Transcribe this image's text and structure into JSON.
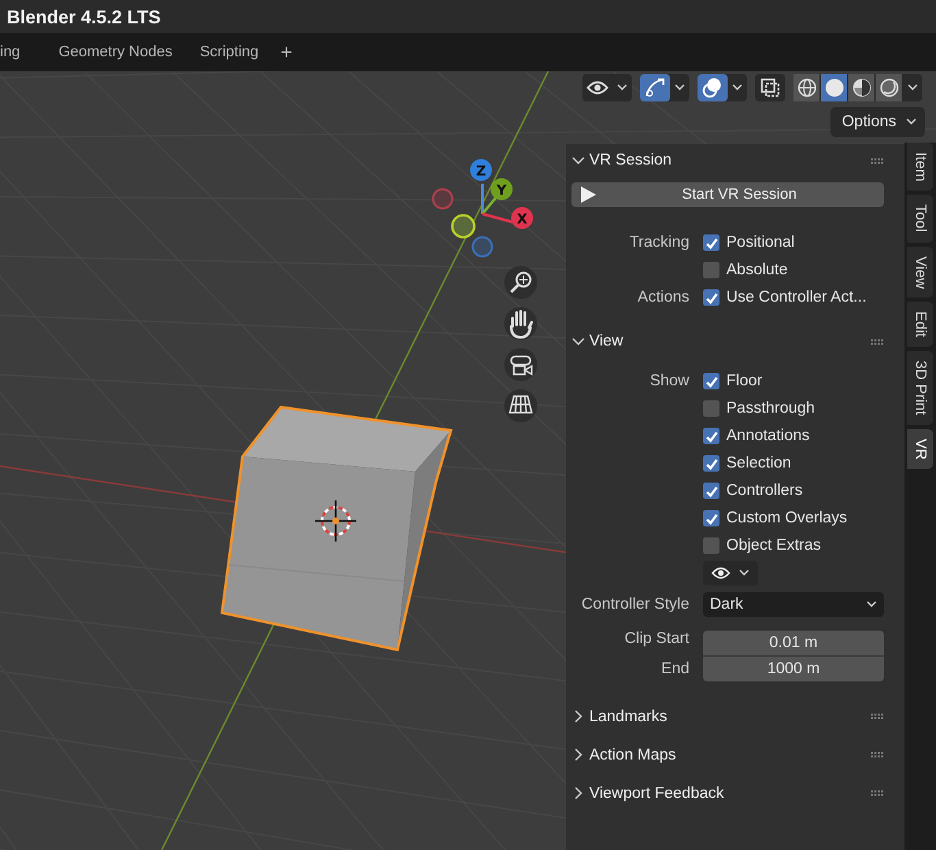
{
  "window": {
    "title": "Blender 4.5.2 LTS"
  },
  "workspace_tabs": [
    {
      "label": "ing",
      "selected": false
    },
    {
      "label": "Geometry Nodes",
      "selected": false
    },
    {
      "label": "Scripting",
      "selected": false
    }
  ],
  "add_tab": "+",
  "gizmo_axes": [
    {
      "label": "Z",
      "color": "#2f7fdc"
    },
    {
      "label": "Y",
      "color": "#6ea01e"
    },
    {
      "label": "X",
      "color": "#e0344e"
    }
  ],
  "header_toggles": [
    {
      "kind": "visibility",
      "on": false
    },
    {
      "kind": "gizmo",
      "on": true
    },
    {
      "kind": "overlay",
      "on": true
    },
    {
      "kind": "xray",
      "on": false
    }
  ],
  "shading_modes": [
    {
      "kind": "wireframe",
      "selected": false
    },
    {
      "kind": "solid",
      "selected": true
    },
    {
      "kind": "material",
      "selected": false
    },
    {
      "kind": "rendered",
      "selected": false
    }
  ],
  "options_button": "Options",
  "vr_session": {
    "title": "VR Session",
    "expanded": true,
    "start_button": "Start VR Session",
    "tracking_label": "Tracking",
    "tracking": [
      {
        "label": "Positional",
        "checked": true
      },
      {
        "label": "Absolute",
        "checked": false
      }
    ],
    "actions_label": "Actions",
    "actions": [
      {
        "label": "Use Controller Act...",
        "checked": true
      }
    ]
  },
  "view": {
    "title": "View",
    "expanded": true,
    "show_label": "Show",
    "show": [
      {
        "label": "Floor",
        "checked": true
      },
      {
        "label": "Passthrough",
        "checked": false
      },
      {
        "label": "Annotations",
        "checked": true
      },
      {
        "label": "Selection",
        "checked": true
      },
      {
        "label": "Controllers",
        "checked": true
      },
      {
        "label": "Custom Overlays",
        "checked": true
      },
      {
        "label": "Object Extras",
        "checked": false
      }
    ],
    "controller_style_label": "Controller Style",
    "controller_style": "Dark",
    "clip_start_label": "Clip Start",
    "clip_start": "0.01 m",
    "clip_end_label": "End",
    "clip_end": "1000 m"
  },
  "collapsed_panels": [
    {
      "title": "Landmarks",
      "expanded": false
    },
    {
      "title": "Action Maps",
      "expanded": false
    },
    {
      "title": "Viewport Feedback",
      "expanded": false
    }
  ],
  "sidebar_tabs": [
    {
      "label": "Item",
      "selected": false
    },
    {
      "label": "Tool",
      "selected": false
    },
    {
      "label": "View",
      "selected": false
    },
    {
      "label": "Edit",
      "selected": false
    },
    {
      "label": "3D Print",
      "selected": false
    },
    {
      "label": "VR",
      "selected": true
    }
  ]
}
